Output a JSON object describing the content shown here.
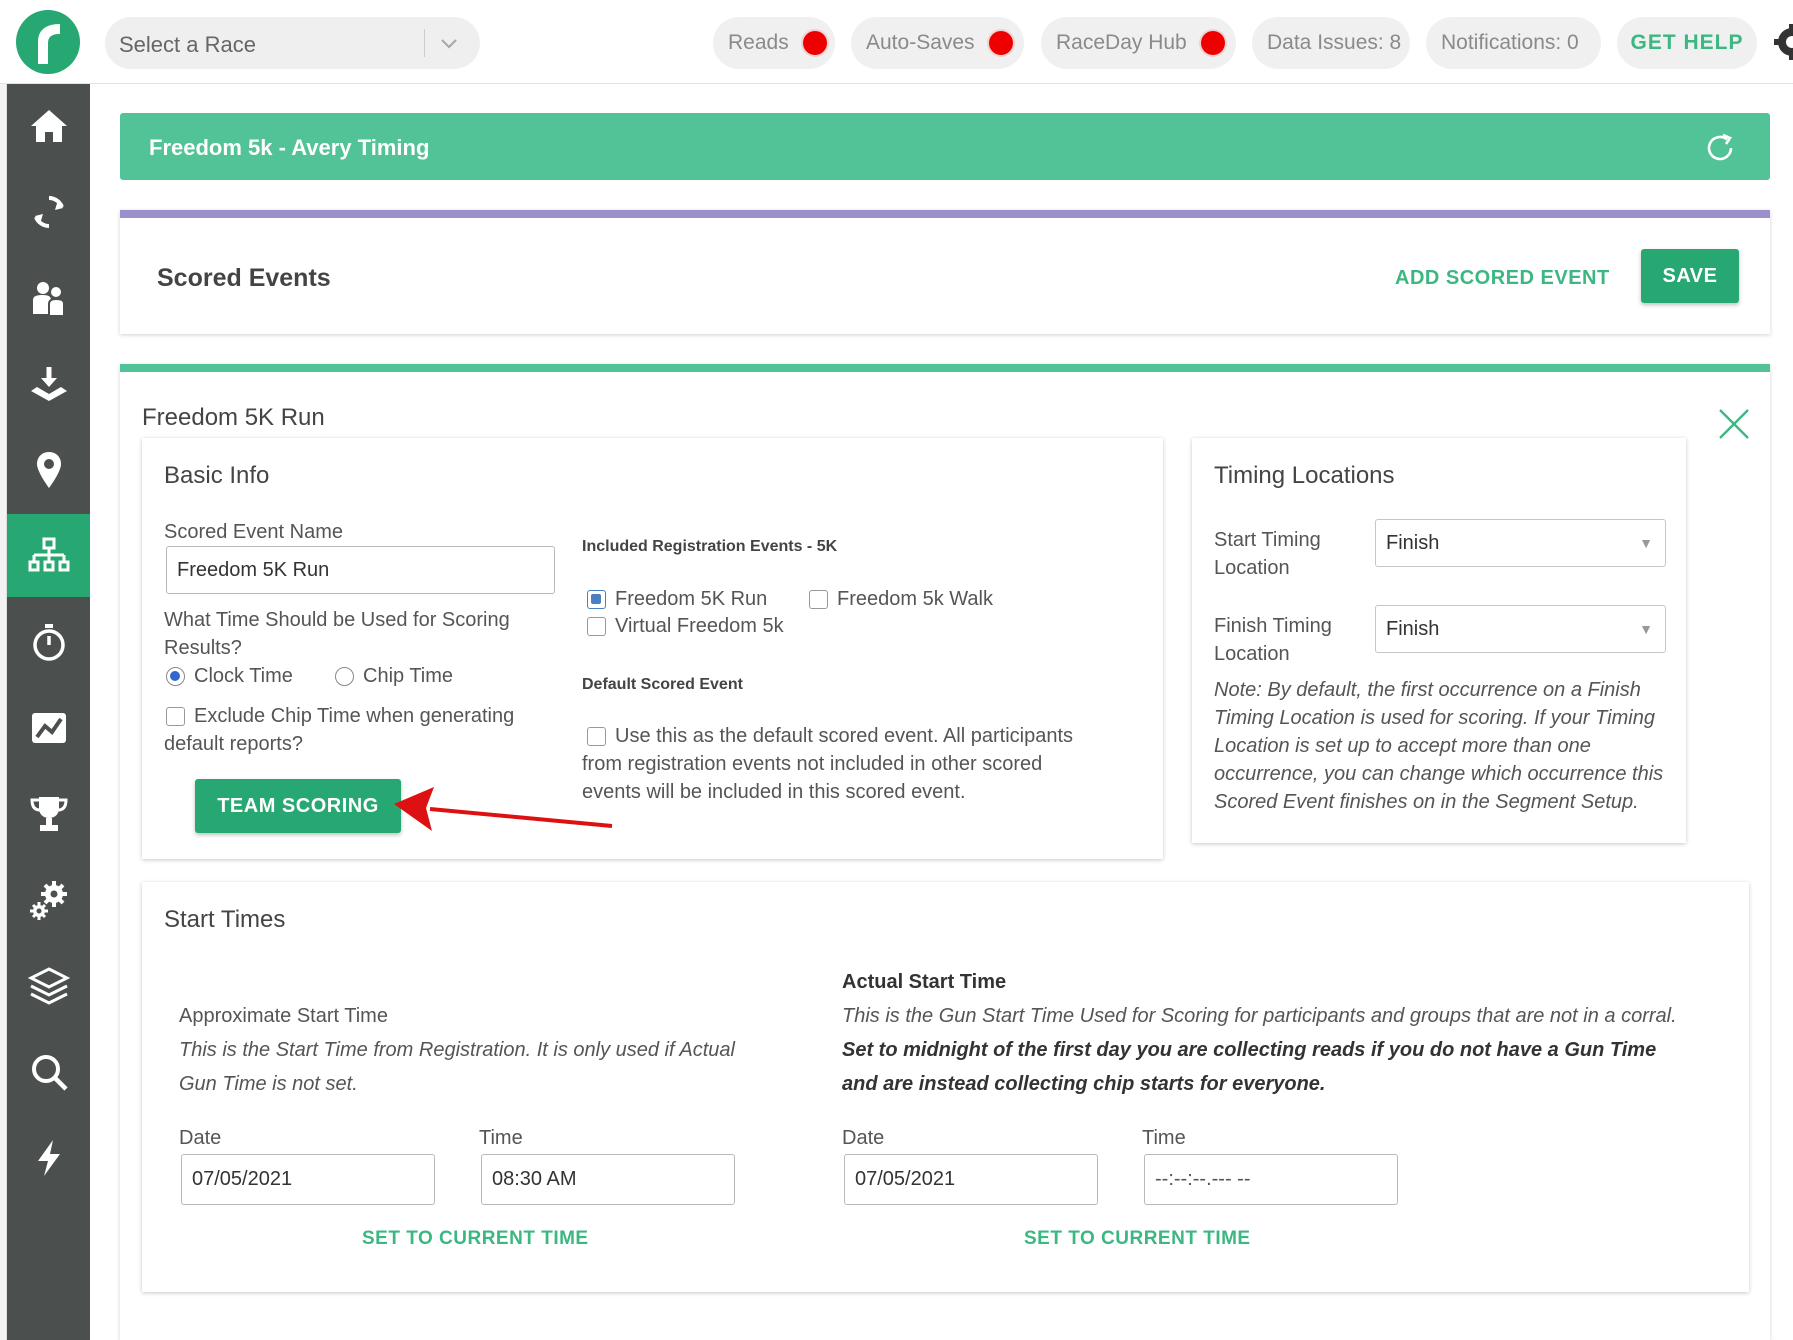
{
  "topbar": {
    "race_select_placeholder": "Select a Race",
    "pills": [
      {
        "label": "Reads",
        "status": "red"
      },
      {
        "label": "Auto-Saves",
        "status": "red"
      },
      {
        "label": "RaceDay Hub",
        "status": "red"
      },
      {
        "label": "Data Issues: 8"
      },
      {
        "label": "Notifications: 0"
      }
    ],
    "help_label": "GET HELP",
    "status_color": "#ee0000"
  },
  "sidebar": {
    "items": [
      {
        "icon": "home-icon"
      },
      {
        "icon": "sync-icon"
      },
      {
        "icon": "participants-icon"
      },
      {
        "icon": "import-icon"
      },
      {
        "icon": "location-pin-icon"
      },
      {
        "icon": "hierarchy-icon",
        "active": true
      },
      {
        "icon": "stopwatch-icon"
      },
      {
        "icon": "line-chart-icon"
      },
      {
        "icon": "trophy-icon"
      },
      {
        "icon": "gears-icon"
      },
      {
        "icon": "layers-icon"
      },
      {
        "icon": "search-icon"
      },
      {
        "icon": "lightning-icon"
      }
    ]
  },
  "race_header": {
    "title": "Freedom 5k  -  Avery Timing"
  },
  "scored_events": {
    "title": "Scored Events",
    "add_label": "ADD SCORED EVENT",
    "save_label": "SAVE"
  },
  "event": {
    "title": "Freedom 5K Run",
    "basic_info": {
      "title": "Basic Info",
      "name_label": "Scored Event Name",
      "name_value": "Freedom 5K Run",
      "time_question_line1": "What Time Should be Used for Scoring",
      "time_question_line2": "Results?",
      "clock_time": "Clock Time",
      "chip_time": "Chip Time",
      "clock_selected": true,
      "exclude_line1": "Exclude Chip Time when generating",
      "exclude_line2": "default reports?",
      "team_scoring_label": "TEAM SCORING",
      "included_title": "Included Registration Events - 5K",
      "reg_events": [
        {
          "label": "Freedom 5K Run",
          "checked": true
        },
        {
          "label": "Freedom 5k Walk",
          "checked": false
        },
        {
          "label": "Virtual Freedom 5k",
          "checked": false
        }
      ],
      "default_title": "Default Scored Event",
      "default_line1": "Use this as the default scored event. All participants",
      "default_line2": "from registration events not included in other scored",
      "default_line3": "events will be included in this scored event."
    },
    "timing_locations": {
      "title": "Timing Locations",
      "start_label_1": "Start Timing",
      "start_label_2": "Location",
      "start_value": "Finish",
      "finish_label_1": "Finish Timing",
      "finish_label_2": "Location",
      "finish_value": "Finish",
      "note_lines": [
        "Note: By default, the first occurrence on a Finish",
        "Timing Location is used for scoring. If your Timing",
        "Location is set up to accept more than one",
        "occurrence, you can change which occurrence this",
        "Scored Event finishes on in the Segment Setup."
      ]
    },
    "start_times": {
      "title": "Start Times",
      "approx": {
        "title": "Approximate Start Time",
        "desc_line1": "This is the Start Time from Registration. It is only used if Actual",
        "desc_line2": "Gun Time is not set.",
        "date_label": "Date",
        "date_value": "07/05/2021",
        "time_label": "Time",
        "time_value": "08:30 AM",
        "set_current": "SET TO CURRENT TIME"
      },
      "actual": {
        "title": "Actual Start Time",
        "desc_line1": "This is the Gun Start Time Used for Scoring for participants and groups that are not in a corral.",
        "bold_line1": "Set to midnight of the first day you are collecting reads if you do not have a Gun Time",
        "bold_line2": "and are instead collecting chip starts for everyone.",
        "date_label": "Date",
        "date_value": "07/05/2021",
        "time_label": "Time",
        "time_value": "--:--:--.--- --",
        "set_current": "SET TO CURRENT TIME"
      }
    }
  },
  "colors": {
    "brand_green": "#27a872",
    "header_green": "#52c396",
    "purple_accent": "#9d8fcb",
    "sidebar": "#4b4f4e",
    "arrow_red": "#dd1111"
  }
}
